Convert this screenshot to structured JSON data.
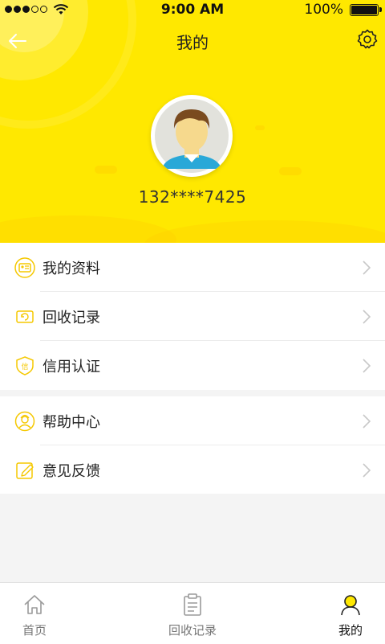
{
  "status_bar": {
    "time": "9:00 AM",
    "battery": "100%"
  },
  "nav": {
    "title": "我的"
  },
  "profile": {
    "phone": "132****7425"
  },
  "menu_groups": [
    {
      "items": [
        {
          "label": "我的资料",
          "icon": "profile-card-icon"
        },
        {
          "label": "回收记录",
          "icon": "recycle-record-icon"
        },
        {
          "label": "信用认证",
          "icon": "credit-shield-icon"
        }
      ]
    },
    {
      "items": [
        {
          "label": "帮助中心",
          "icon": "help-support-icon"
        },
        {
          "label": "意见反馈",
          "icon": "feedback-edit-icon"
        }
      ]
    }
  ],
  "tabbar": {
    "tabs": [
      {
        "label": "首页",
        "icon": "home-icon"
      },
      {
        "label": "回收记录",
        "icon": "clipboard-icon"
      },
      {
        "label": "我的",
        "icon": "user-icon",
        "active": true
      }
    ]
  },
  "colors": {
    "accent": "#ffe800",
    "icon_yellow": "#f5c800"
  }
}
